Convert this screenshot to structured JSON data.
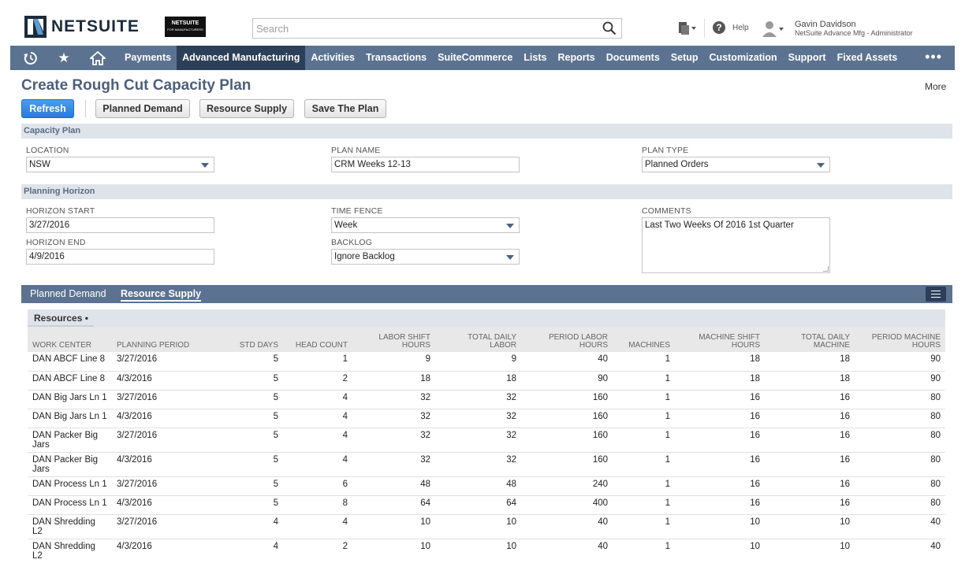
{
  "header": {
    "brand": "NETSUITE",
    "badge_line1": "NETSUITE",
    "badge_line2": "FOR MANUFACTURERS",
    "search_placeholder": "Search",
    "help_label": "Help",
    "user_name": "Gavin Davidson",
    "user_role": "NetSuite Advance Mfg - Administrator"
  },
  "nav": {
    "items": [
      "Payments",
      "Advanced Manufacturing",
      "Activities",
      "Transactions",
      "SuiteCommerce",
      "Lists",
      "Reports",
      "Documents",
      "Setup",
      "Customization",
      "Support",
      "Fixed Assets"
    ],
    "active": "Advanced Manufacturing",
    "more": "•••"
  },
  "page": {
    "title": "Create Rough Cut Capacity Plan",
    "more": "More"
  },
  "buttons": {
    "refresh": "Refresh",
    "planned_demand": "Planned Demand",
    "resource_supply": "Resource Supply",
    "save_plan": "Save The Plan"
  },
  "capacity_plan": {
    "section": "Capacity Plan",
    "location_label": "LOCATION",
    "location_value": "NSW",
    "plan_name_label": "PLAN NAME",
    "plan_name_value": "CRM Weeks 12-13",
    "plan_type_label": "PLAN TYPE",
    "plan_type_value": "Planned Orders"
  },
  "planning_horizon": {
    "section": "Planning Horizon",
    "horizon_start_label": "HORIZON START",
    "horizon_start_value": "3/27/2016",
    "horizon_end_label": "HORIZON END",
    "horizon_end_value": "4/9/2016",
    "time_fence_label": "TIME FENCE",
    "time_fence_value": "Week",
    "backlog_label": "BACKLOG",
    "backlog_value": "Ignore Backlog",
    "comments_label": "COMMENTS",
    "comments_value": "Last Two Weeks Of 2016 1st Quarter"
  },
  "subtabs": {
    "planned_demand": "Planned Demand",
    "resource_supply": "Resource Supply"
  },
  "resources": {
    "tab_label": "Resources •",
    "columns": [
      "WORK CENTER",
      "PLANNING PERIOD",
      "STD DAYS",
      "HEAD COUNT",
      "LABOR SHIFT HOURS",
      "TOTAL DAILY LABOR",
      "PERIOD LABOR HOURS",
      "MACHINES",
      "MACHINE SHIFT HOURS",
      "TOTAL DAILY MACHINE",
      "PERIOD MACHINE HOURS"
    ],
    "rows": [
      [
        "DAN ABCF Line 8",
        "3/27/2016",
        "5",
        "1",
        "9",
        "9",
        "40",
        "1",
        "18",
        "18",
        "90"
      ],
      [
        "DAN ABCF Line 8",
        "4/3/2016",
        "5",
        "2",
        "18",
        "18",
        "90",
        "1",
        "18",
        "18",
        "90"
      ],
      [
        "DAN Big Jars Ln 1",
        "3/27/2016",
        "5",
        "4",
        "32",
        "32",
        "160",
        "1",
        "16",
        "16",
        "80"
      ],
      [
        "DAN Big Jars Ln 1",
        "4/3/2016",
        "5",
        "4",
        "32",
        "32",
        "160",
        "1",
        "16",
        "16",
        "80"
      ],
      [
        "DAN Packer Big Jars",
        "3/27/2016",
        "5",
        "4",
        "32",
        "32",
        "160",
        "1",
        "16",
        "16",
        "80"
      ],
      [
        "DAN Packer Big Jars",
        "4/3/2016",
        "5",
        "4",
        "32",
        "32",
        "160",
        "1",
        "16",
        "16",
        "80"
      ],
      [
        "DAN Process Ln 1",
        "3/27/2016",
        "5",
        "6",
        "48",
        "48",
        "240",
        "1",
        "16",
        "16",
        "80"
      ],
      [
        "DAN Process Ln 1",
        "4/3/2016",
        "5",
        "8",
        "64",
        "64",
        "400",
        "1",
        "16",
        "16",
        "80"
      ],
      [
        "DAN Shredding L2",
        "3/27/2016",
        "4",
        "4",
        "10",
        "10",
        "40",
        "1",
        "10",
        "10",
        "40"
      ],
      [
        "DAN Shredding L2",
        "4/3/2016",
        "4",
        "2",
        "10",
        "10",
        "40",
        "1",
        "10",
        "10",
        "40"
      ]
    ]
  },
  "colors": {
    "nav_bg": "#5c7291",
    "nav_active": "#2b3f58",
    "title": "#4d5f7c",
    "primary_button": "#2a7ad9"
  }
}
